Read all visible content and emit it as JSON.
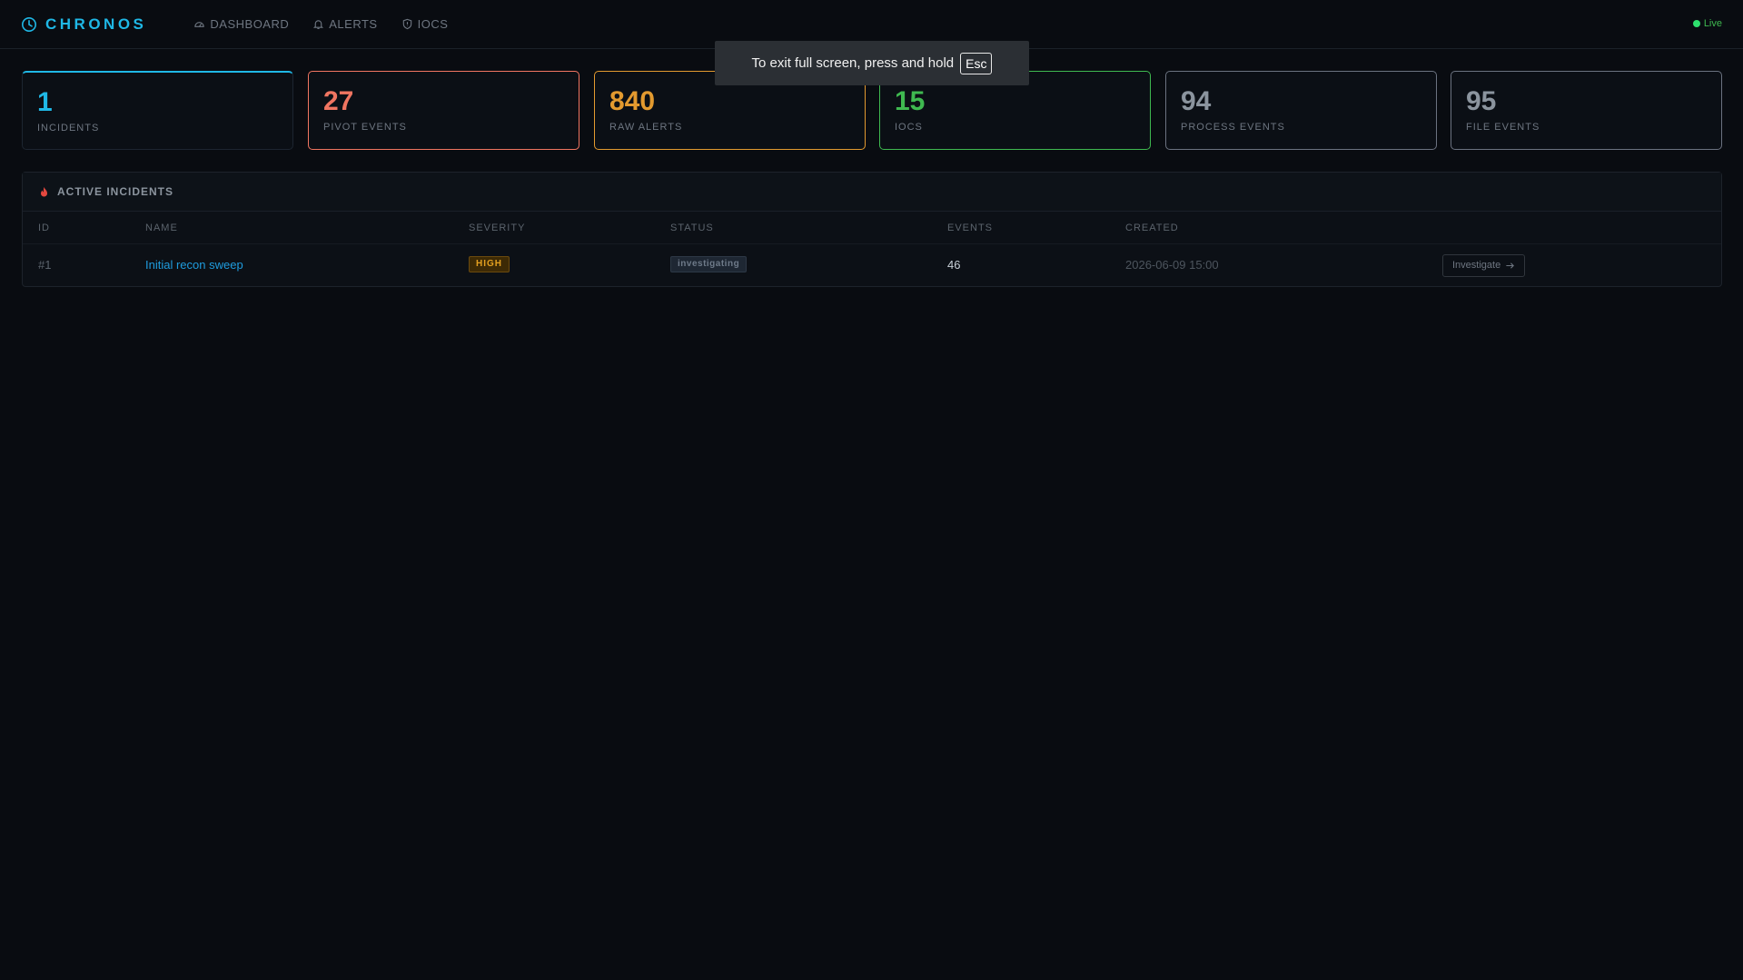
{
  "app": {
    "name": "CHRONOS",
    "status": "Live",
    "accent": "#1fb8e6"
  },
  "nav": [
    {
      "label": "DASHBOARD",
      "icon": "dashboard-icon"
    },
    {
      "label": "ALERTS",
      "icon": "bell-icon"
    },
    {
      "label": "IOCS",
      "icon": "shield-icon"
    }
  ],
  "stats": [
    {
      "value": "1",
      "label": "INCIDENTS",
      "color": "#1fb8e6"
    },
    {
      "value": "27",
      "label": "PIVOT EVENTS",
      "color": "#f07561"
    },
    {
      "value": "840",
      "label": "RAW ALERTS",
      "color": "#e39a2f"
    },
    {
      "value": "15",
      "label": "IOCS",
      "color": "#3fb950"
    },
    {
      "value": "94",
      "label": "PROCESS EVENTS",
      "color": "#8b949e"
    },
    {
      "value": "95",
      "label": "FILE EVENTS",
      "color": "#8b949e"
    }
  ],
  "incidents": {
    "title": "ACTIVE INCIDENTS",
    "columns": [
      "ID",
      "NAME",
      "SEVERITY",
      "STATUS",
      "EVENTS",
      "CREATED"
    ],
    "rows": [
      {
        "id": "#1",
        "name": "Initial recon sweep",
        "severity": "HIGH",
        "status": "investigating",
        "events": "46",
        "created": "2026-06-09 15:00",
        "action": "Investigate"
      }
    ]
  },
  "fullscreen_notice": {
    "text": "To exit full screen, press and hold",
    "key": "Esc"
  }
}
